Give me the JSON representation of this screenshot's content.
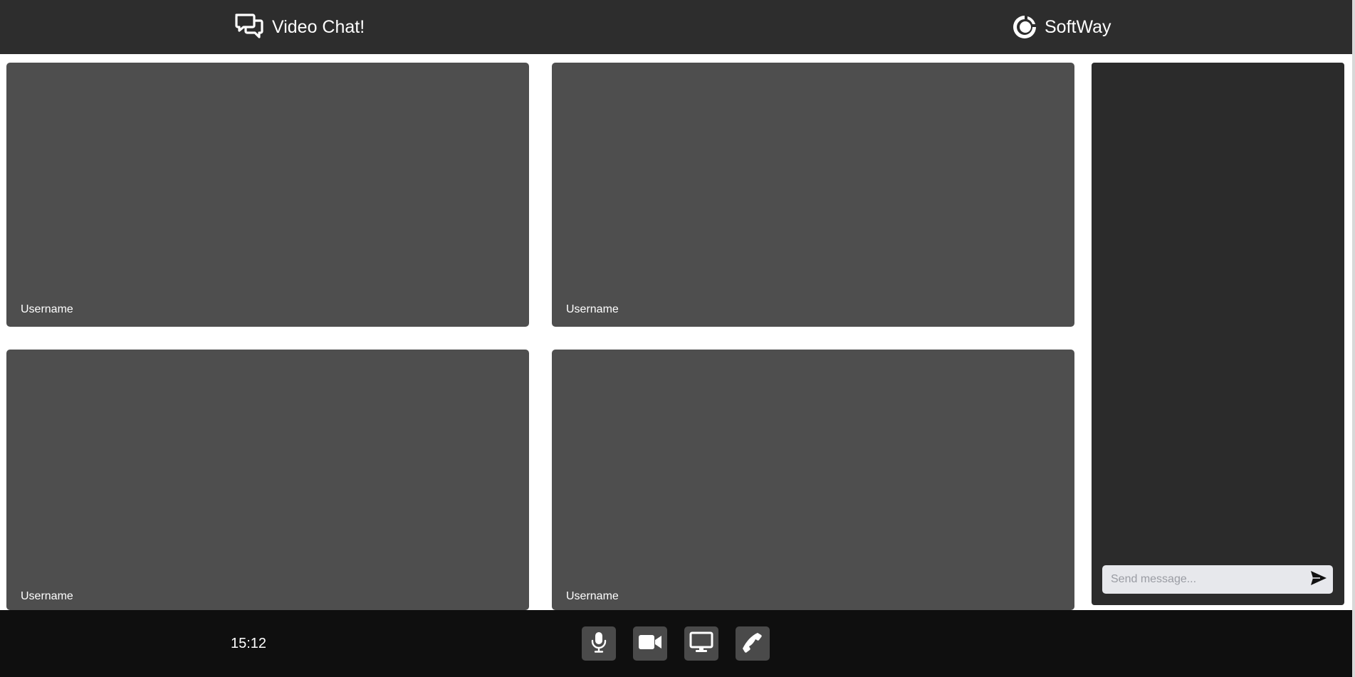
{
  "header": {
    "app_title": "Video Chat!",
    "app_icon": "chat-bubbles-icon",
    "brand_name": "SoftWay",
    "brand_icon": "softway-logo-icon"
  },
  "tiles": [
    {
      "username": "Username"
    },
    {
      "username": "Username"
    },
    {
      "username": "Username"
    },
    {
      "username": "Username"
    }
  ],
  "chat": {
    "input_placeholder": "Send message...",
    "input_value": "",
    "send_icon": "send-arrow-icon"
  },
  "footer": {
    "timer": "15:12",
    "controls": [
      {
        "name": "microphone",
        "icon": "microphone-icon"
      },
      {
        "name": "camera",
        "icon": "video-camera-icon"
      },
      {
        "name": "screen-share",
        "icon": "monitor-icon"
      },
      {
        "name": "call",
        "icon": "phone-icon"
      }
    ]
  },
  "colors": {
    "header_bg": "#2d2d2d",
    "tile_bg": "#4e4e4e",
    "chat_bg": "#2b2b2b",
    "footer_bg": "#0f0f0f",
    "control_bg": "#4a4a4a",
    "input_bg": "#e7e8ec"
  }
}
